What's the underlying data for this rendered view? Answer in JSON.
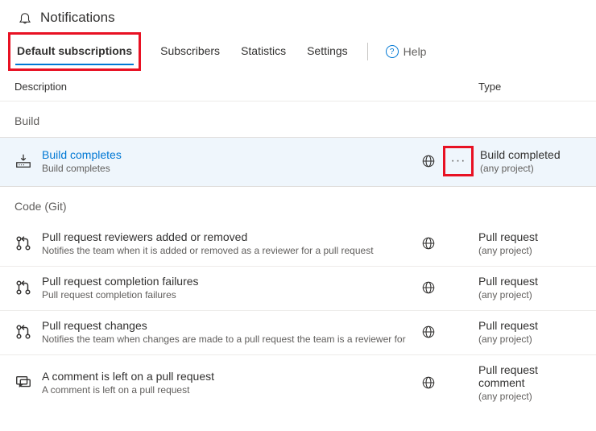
{
  "header": {
    "title": "Notifications"
  },
  "tabs": {
    "default_subscriptions": "Default subscriptions",
    "subscribers": "Subscribers",
    "statistics": "Statistics",
    "settings": "Settings",
    "help": "Help"
  },
  "columns": {
    "description": "Description",
    "type": "Type"
  },
  "groups": {
    "build": {
      "label": "Build"
    },
    "code_git": {
      "label": "Code (Git)"
    }
  },
  "rows": {
    "build_completes": {
      "title": "Build completes",
      "subtitle": "Build completes",
      "type_title": "Build completed",
      "type_sub": "(any project)"
    },
    "pr_reviewers": {
      "title": "Pull request reviewers added or removed",
      "subtitle": "Notifies the team when it is added or removed as a reviewer for a pull request",
      "type_title": "Pull request",
      "type_sub": "(any project)"
    },
    "pr_completion_failures": {
      "title": "Pull request completion failures",
      "subtitle": "Pull request completion failures",
      "type_title": "Pull request",
      "type_sub": "(any project)"
    },
    "pr_changes": {
      "title": "Pull request changes",
      "subtitle": "Notifies the team when changes are made to a pull request the team is a reviewer for",
      "type_title": "Pull request",
      "type_sub": "(any project)"
    },
    "pr_comment": {
      "title": "A comment is left on a pull request",
      "subtitle": "A comment is left on a pull request",
      "type_title": "Pull request comment",
      "type_sub": "(any project)"
    }
  }
}
